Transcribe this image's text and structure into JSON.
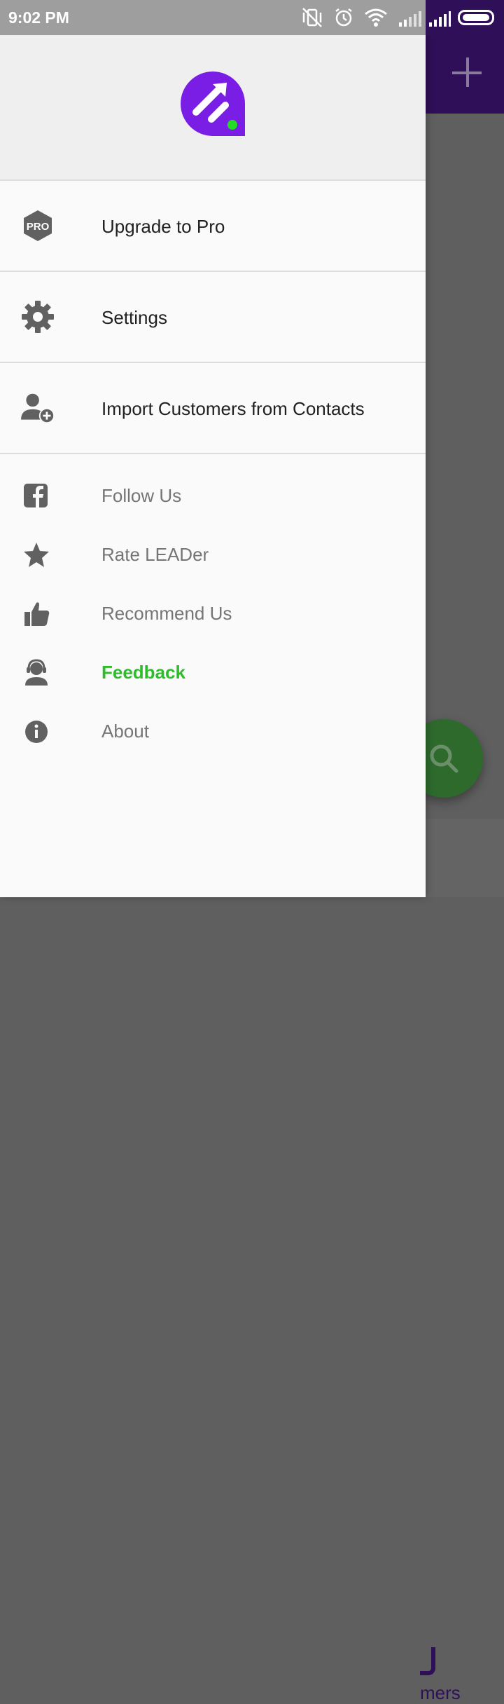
{
  "status_bar": {
    "time": "9:02 PM"
  },
  "drawer": {
    "primary_items": [
      {
        "label": "Upgrade to Pro",
        "icon": "pro-badge-icon"
      },
      {
        "label": "Settings",
        "icon": "gear-icon"
      },
      {
        "label": "Import Customers from Contacts",
        "icon": "add-person-icon"
      }
    ],
    "secondary_items": [
      {
        "label": "Follow Us",
        "icon": "facebook-icon"
      },
      {
        "label": "Rate LEADer",
        "icon": "star-icon"
      },
      {
        "label": "Recommend Us",
        "icon": "thumbs-up-icon"
      },
      {
        "label": "Feedback",
        "icon": "headset-person-icon",
        "color": "#2ebd2a"
      },
      {
        "label": "About",
        "icon": "info-icon"
      }
    ],
    "pro_badge_text": "PRO"
  },
  "background": {
    "bottom_tab_label": "mers"
  },
  "colors": {
    "brand_purple": "#7a1ee6",
    "toolbar": "#2f0f58",
    "accent_green": "#2ebd2a"
  }
}
